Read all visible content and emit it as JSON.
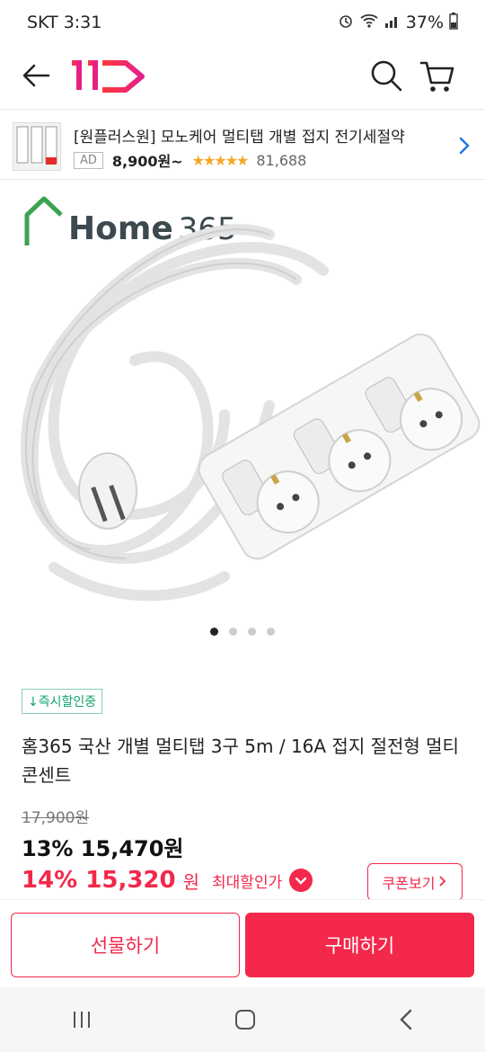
{
  "status": {
    "carrier_time": "SKT 3:31",
    "battery": "37%"
  },
  "header": {
    "icons": [
      "back-arrow-icon",
      "11st-logo",
      "search-icon",
      "cart-icon"
    ]
  },
  "ad": {
    "title": "[원플러스원] 모노케어 멀티탭 개별 접지 전기세절약",
    "badge": "AD",
    "price": "8,900원~",
    "stars": "★★★★★",
    "review_count": "81,688"
  },
  "hero": {
    "brand": "Home",
    "brand_num": "365",
    "slides": [
      true,
      false,
      false,
      false
    ]
  },
  "product": {
    "tag": "↓즉시할인중",
    "title": "홈365 국산 개별 멀티탭 3구 5m / 16A 접지 절전형 멀티콘센트",
    "original_price": "17,900원",
    "price1": "13% 15,470원",
    "price2_value": "14% 15,320",
    "price2_unit": "원",
    "price2_label": "최대할인가",
    "coupon": "쿠폰보기"
  },
  "actions": {
    "gift": "선물하기",
    "buy": "구매하기"
  },
  "colors": {
    "accent": "#f3284b",
    "tag_green": "#10a36b"
  }
}
